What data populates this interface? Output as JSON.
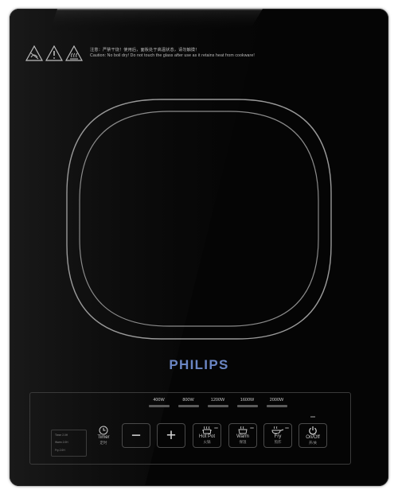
{
  "warning": {
    "line_cn": "注意：严禁干烧！使用后，面板处于高温状态，请勿触摸！",
    "line_en": "Caution: No boil dry! Do not touch the glass after use as it retains heat from cookware!",
    "icons": [
      "warning-triangle-icon",
      "warning-triangle-icon",
      "hot-surface-warning-icon"
    ]
  },
  "brand": "PHILIPS",
  "power_levels": [
    "400W",
    "800W",
    "1200W",
    "1600W",
    "2000W"
  ],
  "timer_display": [
    "Timer 2.0H",
    "Warm 2.0H",
    "Fry 2.0H"
  ],
  "buttons": {
    "timer": {
      "label": "Timer",
      "sub": "定时"
    },
    "minus": {
      "symbol": "−"
    },
    "plus": {
      "symbol": "+"
    },
    "hot_pot": {
      "label": "Hot Pot",
      "sub": "火锅"
    },
    "warm": {
      "label": "Warm",
      "sub": "保温"
    },
    "fry": {
      "label": "Fry",
      "sub": "煎炸"
    },
    "onoff": {
      "label": "On/Off",
      "sub": "开/关"
    }
  },
  "colors": {
    "glass": "#050505",
    "brand_blue": "#6b86c4",
    "zone_line": "#9a9a9a",
    "panel_line": "#3a3a3a"
  }
}
